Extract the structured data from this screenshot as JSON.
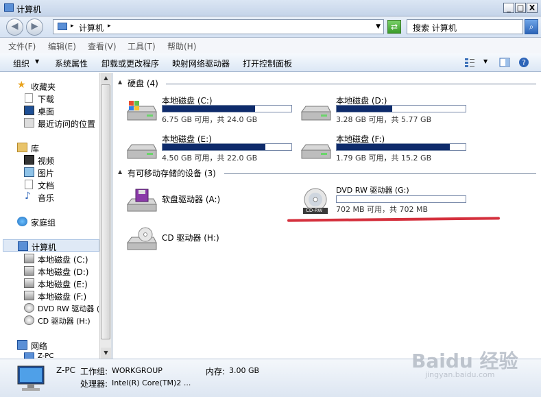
{
  "window": {
    "title": "计算机",
    "min": "_",
    "max": "□",
    "close": "X"
  },
  "address": {
    "path_label": "计算机",
    "search_placeholder": "搜索 计算机"
  },
  "menu": {
    "items": [
      "文件(F)",
      "编辑(E)",
      "查看(V)",
      "工具(T)",
      "帮助(H)"
    ]
  },
  "toolbar": {
    "items": [
      "组织",
      "系统属性",
      "卸载或更改程序",
      "映射网络驱动器",
      "打开控制面板"
    ]
  },
  "sidebar": {
    "favorites": {
      "label": "收藏夹",
      "items": [
        "下载",
        "桌面",
        "最近访问的位置"
      ]
    },
    "library": {
      "label": "库",
      "items": [
        "视频",
        "图片",
        "文档",
        "音乐"
      ]
    },
    "homegroup": "家庭组",
    "computer": {
      "label": "计算机",
      "items": [
        "本地磁盘 (C:)",
        "本地磁盘 (D:)",
        "本地磁盘 (E:)",
        "本地磁盘 (F:)",
        "DVD RW 驱动器 (",
        "CD 驱动器 (H:)"
      ]
    },
    "network": {
      "label": "网络",
      "items": [
        "Z-PC"
      ]
    }
  },
  "groups": {
    "hdd": {
      "label": "硬盘 (4)"
    },
    "removable": {
      "label": "有可移动存储的设备 (3)"
    }
  },
  "drives": [
    {
      "name": "本地磁盘 (C:)",
      "info": "6.75 GB 可用，共 24.0 GB",
      "used_fraction": 0.72
    },
    {
      "name": "本地磁盘 (D:)",
      "info": "3.28 GB 可用，共 5.77 GB",
      "used_fraction": 0.43
    },
    {
      "name": "本地磁盘 (E:)",
      "info": "4.50 GB 可用，共 22.0 GB",
      "used_fraction": 0.8
    },
    {
      "name": "本地磁盘 (F:)",
      "info": "1.79 GB 可用，共 15.2 GB",
      "used_fraction": 0.88
    }
  ],
  "removable": [
    {
      "name": "软盘驱动器 (A:)"
    },
    {
      "name": "DVD RW 驱动器 (G:)",
      "info": "702 MB 可用，共 702 MB",
      "used_fraction": 0.0,
      "badge": "CD-RW"
    },
    {
      "name": "CD 驱动器 (H:)"
    }
  ],
  "status": {
    "pc_name": "Z-PC",
    "workgroup_label": "工作组:",
    "workgroup": "WORKGROUP",
    "memory_label": "内存:",
    "memory": "3.00 GB",
    "cpu_label": "处理器:",
    "cpu": "Intel(R) Core(TM)2 ..."
  },
  "watermark": {
    "logo": "Baidu 经验",
    "url": "jingyan.baidu.com"
  }
}
